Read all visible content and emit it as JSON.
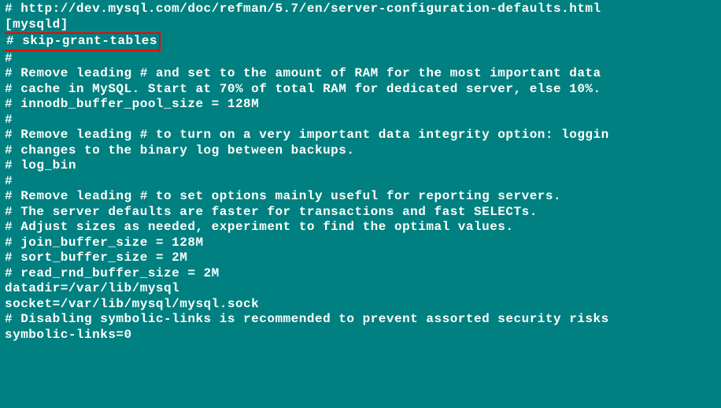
{
  "lines": {
    "l0": "# http://dev.mysql.com/doc/refman/5.7/en/server-configuration-defaults.html",
    "l1": "",
    "l2": "[mysqld]",
    "l3": "# skip-grant-tables",
    "l4": "#",
    "l5": "# Remove leading # and set to the amount of RAM for the most important data",
    "l6": "# cache in MySQL. Start at 70% of total RAM for dedicated server, else 10%.",
    "l7": "# innodb_buffer_pool_size = 128M",
    "l8": "#",
    "l9": "# Remove leading # to turn on a very important data integrity option: loggin",
    "l10": "# changes to the binary log between backups.",
    "l11": "# log_bin",
    "l12": "#",
    "l13": "# Remove leading # to set options mainly useful for reporting servers.",
    "l14": "# The server defaults are faster for transactions and fast SELECTs.",
    "l15": "# Adjust sizes as needed, experiment to find the optimal values.",
    "l16": "# join_buffer_size = 128M",
    "l17": "# sort_buffer_size = 2M",
    "l18": "# read_rnd_buffer_size = 2M",
    "l19": "datadir=/var/lib/mysql",
    "l20": "socket=/var/lib/mysql/mysql.sock",
    "l21": "",
    "l22": "# Disabling symbolic-links is recommended to prevent assorted security risks",
    "l23": "symbolic-links=0"
  }
}
